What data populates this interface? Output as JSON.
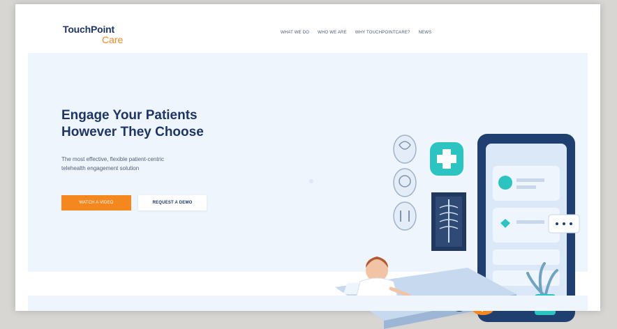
{
  "logo": {
    "line1": "TouchPoint",
    "line2": "Care"
  },
  "nav": {
    "items": [
      {
        "label": "WHAT WE DO"
      },
      {
        "label": "WHO WE ARE"
      },
      {
        "label": "WHY TOUCHPOINTCARE?"
      },
      {
        "label": "NEWS"
      }
    ]
  },
  "hero": {
    "title_line1": "Engage Your Patients",
    "title_line2": "However They Choose",
    "subtitle_line1": "The most effective, flexible patient-centric",
    "subtitle_line2": "telehealth engagement solution",
    "primary_button": "WATCH A VIDEO",
    "secondary_button": "REQUEST A DEMO"
  },
  "colors": {
    "brand_navy": "#1e3566",
    "brand_orange": "#f4871e",
    "hero_bg": "#eef5fc",
    "accent_teal": "#2cc4c0"
  }
}
